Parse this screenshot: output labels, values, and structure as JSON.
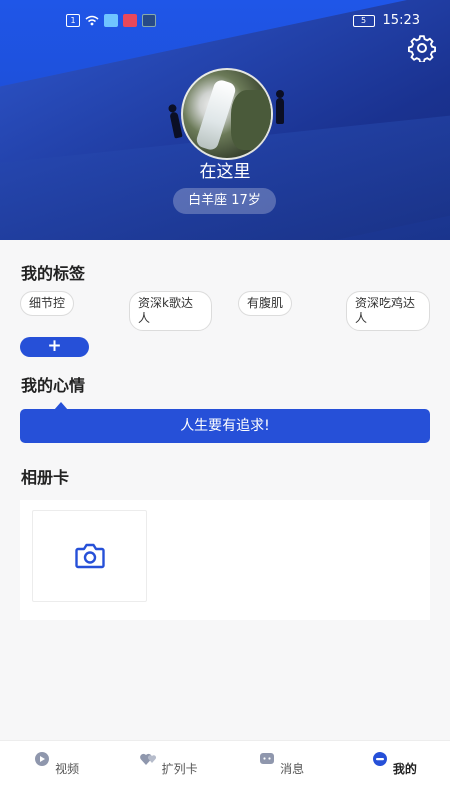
{
  "status_bar": {
    "time": "15:23",
    "battery": "5",
    "icons": [
      "sim-icon",
      "wifi-icon",
      "app-notification-icon",
      "app-notification-icon",
      "app-notification-icon"
    ]
  },
  "profile": {
    "nickname": "在这里",
    "zodiac_age": "白羊座  17岁"
  },
  "tags_section": {
    "title": "我的标签",
    "tags": [
      "细节控",
      "资深k歌达人",
      "有腹肌",
      "资深吃鸡达人"
    ],
    "add_label": "+"
  },
  "mood_section": {
    "title": "我的心情",
    "mood": "人生要有追求!"
  },
  "album_section": {
    "title": "相册卡"
  },
  "bottom_nav": {
    "items": [
      {
        "label": "视频",
        "icon": "video-icon",
        "active": false
      },
      {
        "label": "扩列卡",
        "icon": "hearts-icon",
        "active": false
      },
      {
        "label": "消息",
        "icon": "message-icon",
        "active": false
      },
      {
        "label": "我的",
        "icon": "profile-icon",
        "active": true
      }
    ]
  },
  "colors": {
    "accent": "#2650d8",
    "header_blue": "#1f56e8",
    "background": "#f7f7f8"
  }
}
